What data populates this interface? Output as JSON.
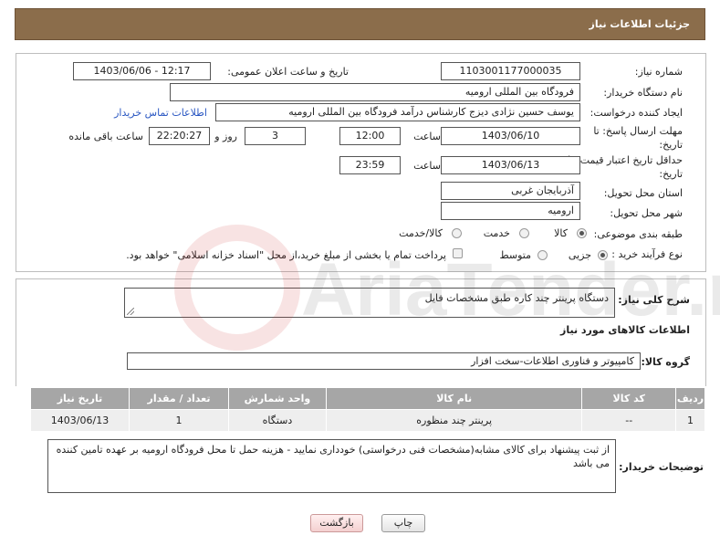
{
  "header": {
    "title": "جزئیات اطلاعات نیاز"
  },
  "form": {
    "need_number": {
      "label": "شماره نیاز:",
      "value": "1103001177000035"
    },
    "announce_datetime": {
      "label": "تاریخ و ساعت اعلان عمومی:",
      "value": "1403/06/06 - 12:17"
    },
    "buyer_org": {
      "label": "نام دستگاه خریدار:",
      "value": "فرودگاه بین المللی ارومیه"
    },
    "requester": {
      "label": "ایجاد کننده درخواست:",
      "value": "یوسف حسین نژادی دیزج کارشناس درآمد فرودگاه بین المللی ارومیه",
      "contact_link": "اطلاعات تماس خریدار"
    },
    "reply_deadline": {
      "label": "مهلت ارسال پاسخ: تا تاریخ:",
      "date": "1403/06/10",
      "time_label": "ساعت",
      "time": "12:00",
      "days": "3",
      "days_label": "روز و",
      "remaining": "22:20:27",
      "remaining_label": "ساعت باقی مانده"
    },
    "price_validity": {
      "label": "حداقل تاریخ اعتبار قیمت: تا تاریخ:",
      "date": "1403/06/13",
      "time_label": "ساعت",
      "time": "23:59"
    },
    "delivery_province": {
      "label": "استان محل تحویل:",
      "value": "آذربایجان غربی"
    },
    "delivery_city": {
      "label": "شهر محل تحویل:",
      "value": "ارومیه"
    },
    "category": {
      "label": "طبقه بندی موضوعی:",
      "options": [
        "کالا",
        "خدمت",
        "کالا/خدمت"
      ],
      "selected": "کالا"
    },
    "purchase_type": {
      "label": "نوع فرآیند خرید :",
      "options": [
        "جزیی",
        "متوسط"
      ],
      "selected": "جزیی",
      "note": "پرداخت تمام یا بخشی از مبلغ خرید،از محل \"اسناد خزانه اسلامی\" خواهد بود."
    }
  },
  "description": {
    "label": "شرح کلی نیاز:",
    "value": "دستگاه پرینتر چند کاره طبق مشخصات فایل"
  },
  "goods_section": {
    "title": "اطلاعات کالاهای مورد نیاز"
  },
  "goods_group": {
    "label": "گروه کالا:",
    "value": "کامپیوتر و فناوری اطلاعات-سخت افزار"
  },
  "table": {
    "headers": [
      "ردیف",
      "کد کالا",
      "نام کالا",
      "واحد شمارش",
      "تعداد / مقدار",
      "تاریخ نیاز"
    ],
    "rows": [
      [
        "1",
        "--",
        "پرینتر چند منظوره",
        "دستگاه",
        "1",
        "1403/06/13"
      ]
    ]
  },
  "buyer_notes": {
    "label": "توضیحات خریدار:",
    "value": "از ثبت پیشنهاد برای کالای مشابه(مشخصات فنی درخواستی) خودداری نمایید - هزینه حمل تا محل فرودگاه ارومیه بر عهده تامین کننده می باشد"
  },
  "buttons": {
    "print": "چاپ",
    "back": "بازگشت"
  },
  "watermark": {
    "text": "AriaTender.net"
  }
}
